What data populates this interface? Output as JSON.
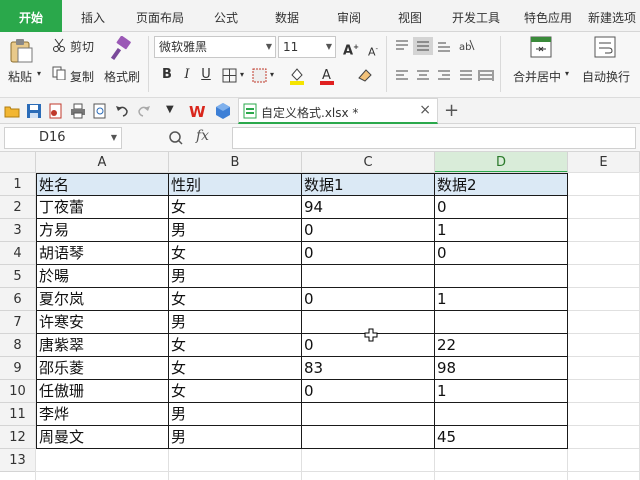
{
  "tabs": [
    "开始",
    "插入",
    "页面布局",
    "公式",
    "数据",
    "审阅",
    "视图",
    "开发工具",
    "特色应用",
    "新建选项"
  ],
  "ribbon": {
    "paste": "粘贴",
    "cut": "剪切",
    "copy": "复制",
    "format_painter": "格式刷",
    "font_name": "微软雅黑",
    "font_size": "11",
    "merge_center": "合并居中",
    "wrap_text": "自动换行"
  },
  "document": {
    "tab_title": "自定义格式.xlsx *"
  },
  "formula_bar": {
    "name_box": "D16",
    "fx": "fx"
  },
  "sheet": {
    "columns": [
      "A",
      "B",
      "C",
      "D",
      "E"
    ],
    "row_numbers": [
      "1",
      "2",
      "3",
      "4",
      "5",
      "6",
      "7",
      "8",
      "9",
      "10",
      "11",
      "12",
      "13"
    ],
    "header": [
      "姓名",
      "性别",
      "数据1",
      "数据2"
    ],
    "rows": [
      [
        "丁夜蕾",
        "女",
        "94",
        "0"
      ],
      [
        "方易",
        "男",
        "0",
        "1"
      ],
      [
        "胡语琴",
        "女",
        "0",
        "0"
      ],
      [
        "於暘",
        "男",
        "",
        ""
      ],
      [
        "夏尔岚",
        "女",
        "0",
        "1"
      ],
      [
        "许寒安",
        "男",
        "",
        ""
      ],
      [
        "唐紫翠",
        "女",
        "0",
        "22"
      ],
      [
        "邵乐菱",
        "女",
        "83",
        "98"
      ],
      [
        "任傲珊",
        "女",
        "0",
        "1"
      ],
      [
        "李烨",
        "男",
        "",
        ""
      ],
      [
        "周曼文",
        "男",
        "",
        "45"
      ]
    ]
  },
  "colors": {
    "accent": "#2aa84b",
    "header_fill": "#dbe9f5"
  }
}
